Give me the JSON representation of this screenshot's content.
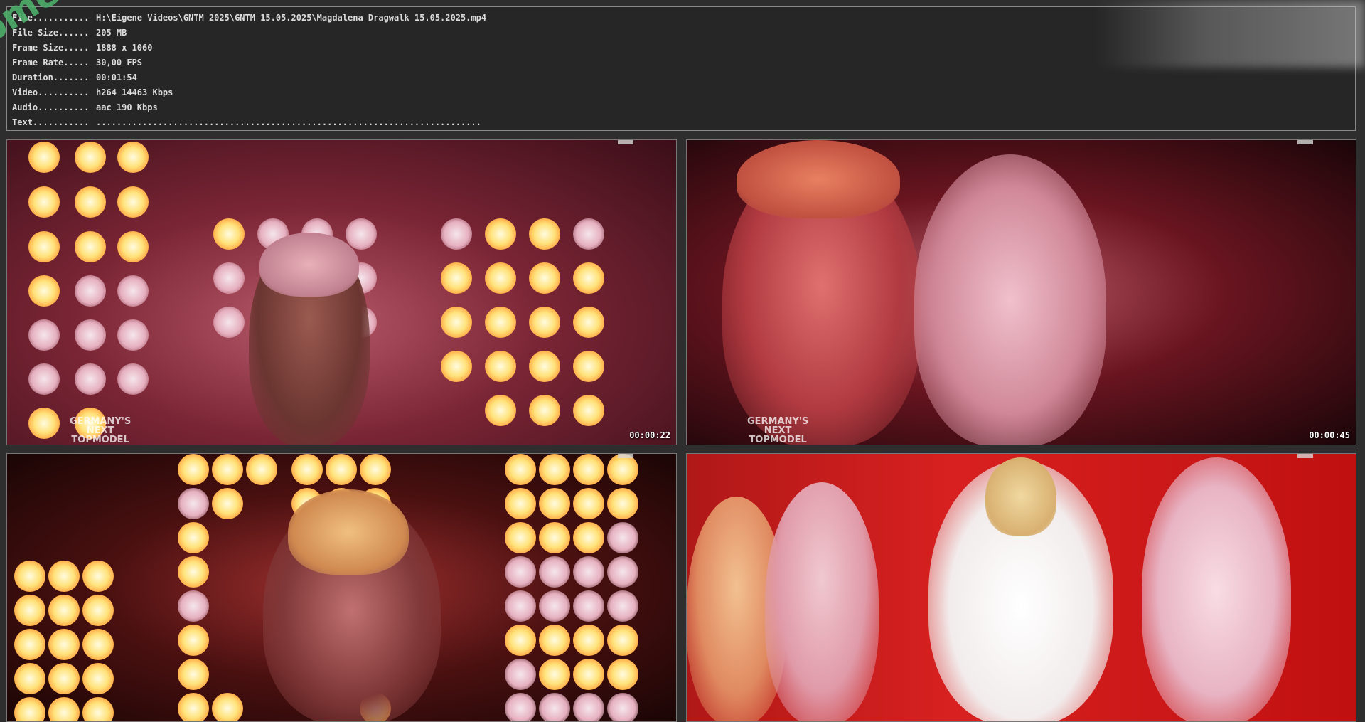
{
  "info": {
    "rows": [
      {
        "key": "File...........",
        "value": "H:\\Eigene Videos\\GNTM 2025\\GNTM 15.05.2025\\Magdalena Dragwalk 15.05.2025.mp4"
      },
      {
        "key": "File Size......",
        "value": "205 MB"
      },
      {
        "key": "Frame Size.....",
        "value": "1888 x 1060"
      },
      {
        "key": "Frame Rate.....",
        "value": "30,00 FPS"
      },
      {
        "key": "Duration.......",
        "value": "00:01:54"
      },
      {
        "key": "Video..........",
        "value": "h264 14463 Kbps"
      },
      {
        "key": "Audio..........",
        "value": "aac 190 Kbps"
      },
      {
        "key": "Text...........",
        "value": "..........................................................................."
      }
    ]
  },
  "watermark": {
    "text": "fapmenu.com"
  },
  "thumbnails": [
    {
      "timestamp": "00:00:22",
      "logo_line1": "GERMANY'S",
      "logo_line2": "NEXT",
      "logo_line3": "TOPMODEL"
    },
    {
      "timestamp": "00:00:45",
      "logo_line1": "GERMANY'S",
      "logo_line2": "NEXT",
      "logo_line3": "TOPMODEL"
    },
    {
      "timestamp": ""
    },
    {
      "timestamp": ""
    }
  ],
  "colors": {
    "background": "#2e2e2e",
    "panel": "#262626",
    "panel_border": "#8a8a8a",
    "watermark": "#4caf6a"
  }
}
